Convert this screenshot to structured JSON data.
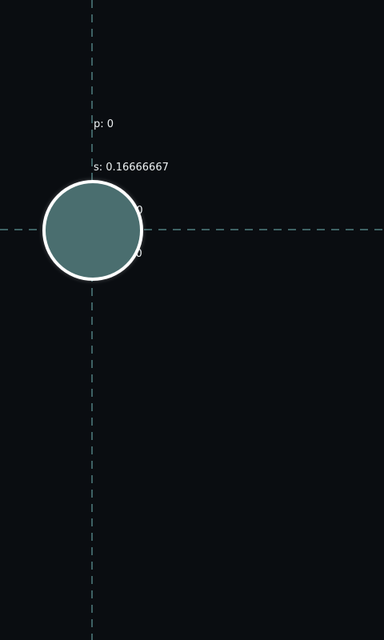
{
  "colors": {
    "background": "#0a0d11",
    "guide_line": "#4f7f80",
    "handle_fill": "#4a6e6f",
    "handle_border": "#ffffff",
    "readout_text": "#eef2f3"
  },
  "readout": {
    "p": "p: 0",
    "s": "s: 0.16666667",
    "x": "x: 115,00",
    "y": "y: 287,00"
  },
  "handle": {
    "icon": "circle-drag-handle"
  }
}
